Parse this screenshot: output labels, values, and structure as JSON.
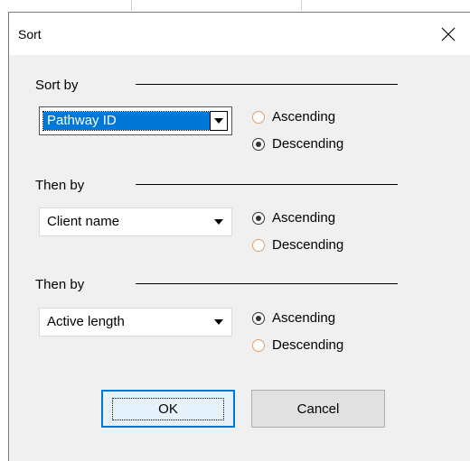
{
  "dialog": {
    "title": "Sort",
    "close_icon": "close-icon"
  },
  "sort_by": {
    "label": "Sort by",
    "selected": "Pathway ID",
    "options": [
      "Ascending",
      "Descending"
    ],
    "checked": "Descending"
  },
  "then_by_1": {
    "label": "Then by",
    "selected": "Client name",
    "options": [
      "Ascending",
      "Descending"
    ],
    "checked": "Ascending"
  },
  "then_by_2": {
    "label": "Then by",
    "selected": "Active length",
    "options": [
      "Ascending",
      "Descending"
    ],
    "checked": "Ascending"
  },
  "buttons": {
    "ok": "OK",
    "cancel": "Cancel"
  },
  "colors": {
    "selection": "#0078d7",
    "dialog_bg": "#f0f0f0"
  }
}
